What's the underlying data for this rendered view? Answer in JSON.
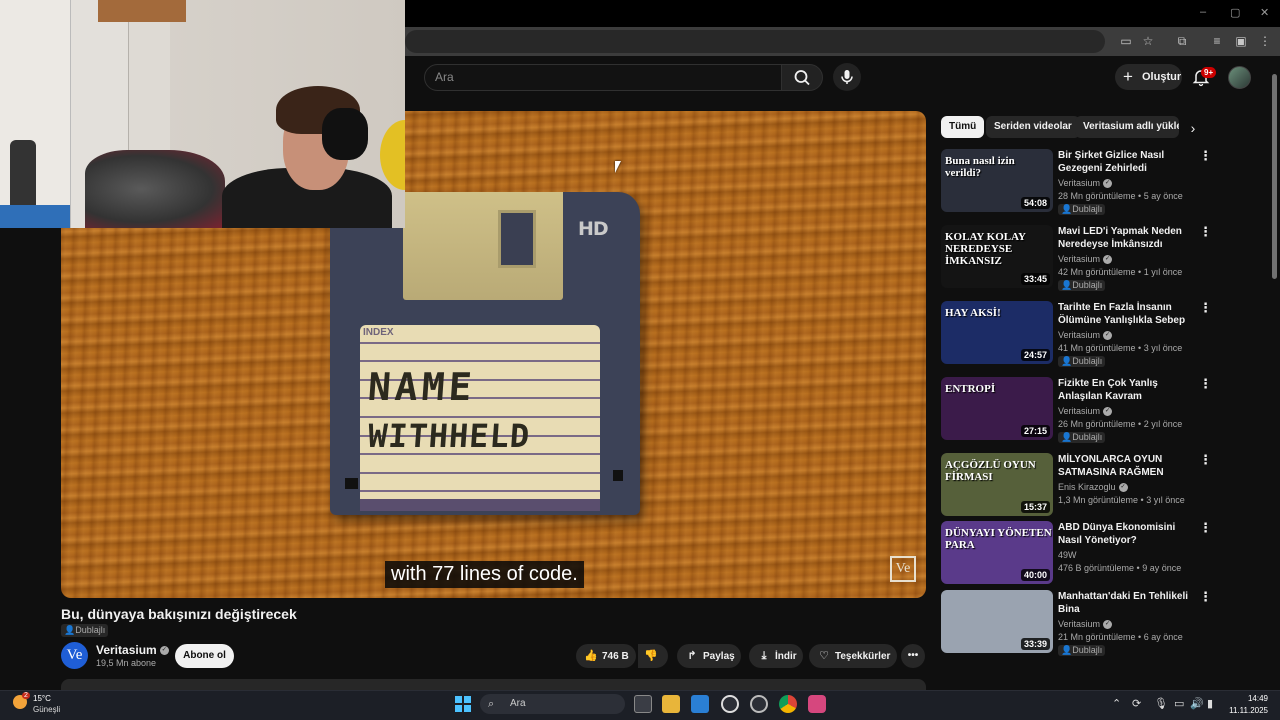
{
  "browser": {
    "window_controls": [
      "–",
      "▢",
      "✕"
    ],
    "toolbar_icons": [
      "cast-icon",
      "star-icon",
      "extensions-icon",
      "media-icon",
      "profile-icon",
      "menu-icon"
    ]
  },
  "header": {
    "search_placeholder": "Ara",
    "create_label": "Oluştur",
    "notifications_badge": "9+"
  },
  "player": {
    "subtitle": "with 77 lines of code.",
    "watermark": "Ve",
    "disk_label_index": "INDEX",
    "disk_label_line1": "NAME",
    "disk_label_line2": "WITHHELD",
    "disk_mark": "HD"
  },
  "video": {
    "title": "Bu, dünyaya bakışınızı değiştirecek",
    "dub_tag": "Dublajlı",
    "channel": {
      "avatar_text": "Ve",
      "name": "Veritasium",
      "subscribers": "19,5 Mn abone",
      "subscribe_label": "Abone ol"
    },
    "actions": {
      "likes": "746 B",
      "share": "Paylaş",
      "download": "İndir",
      "thanks": "Teşekkürler"
    }
  },
  "sidebar": {
    "chips": [
      "Tümü",
      "Seriden videolar",
      "Veritasium adlı yükle"
    ],
    "recommendations": [
      {
        "title": "Bir Şirket Gizlice Nasıl Gezegeni Zehirledi",
        "channel": "Veritasium",
        "verified": true,
        "meta": "28 Mn görüntüleme • 5 ay önce",
        "dub": "Dublajlı",
        "duration": "54:08",
        "thumb_text": "Buna nasıl izin verildi?",
        "thumb_color": "#2a2e3a"
      },
      {
        "title": "Mavi LED'i Yapmak Neden Neredeyse İmkânsızdı",
        "channel": "Veritasium",
        "verified": true,
        "meta": "42 Mn görüntüleme • 1 yıl önce",
        "dub": "Dublajlı",
        "duration": "33:45",
        "thumb_text": "KOLAY   KOLAY   NEREDEYSE İMKANSIZ",
        "thumb_color": "#141414"
      },
      {
        "title": "Tarihte En Fazla İnsanın Ölümüne Yanlışlıkla Sebep Ola...",
        "channel": "Veritasium",
        "verified": true,
        "meta": "41 Mn görüntüleme • 3 yıl önce",
        "dub": "Dublajlı",
        "duration": "24:57",
        "thumb_text": "HAY AKSİ!",
        "thumb_color": "#1c2c66"
      },
      {
        "title": "Fizikte En Çok Yanlış Anlaşılan Kavram",
        "channel": "Veritasium",
        "verified": true,
        "meta": "26 Mn görüntüleme • 2 yıl önce",
        "dub": "Dublajlı",
        "duration": "27:15",
        "thumb_text": "ENTROPİ",
        "thumb_color": "#3b1b4a"
      },
      {
        "title": "MİLYONLARCA OYUN SATMASINA RAĞMEN BATAN ...",
        "channel": "Enis Kirazoglu",
        "verified": true,
        "meta": "1,3 Mn görüntüleme • 3 yıl önce",
        "dub": "",
        "duration": "15:37",
        "thumb_text": "AÇGÖZLÜ OYUN FİRMASI",
        "thumb_color": "#56603a"
      },
      {
        "title": "ABD Dünya Ekonomisini Nasıl Yönetiyor?",
        "channel": "49W",
        "verified": false,
        "meta": "476 B görüntüleme • 9 ay önce",
        "dub": "",
        "duration": "40:00",
        "thumb_text": "DÜNYAYI YÖNETEN PARA",
        "thumb_color": "#5a3a8a"
      },
      {
        "title": "Manhattan'daki En Tehlikeli Bina",
        "channel": "Veritasium",
        "verified": true,
        "meta": "21 Mn görüntüleme • 6 ay önce",
        "dub": "Dublajlı",
        "duration": "33:39",
        "thumb_text": "",
        "thumb_color": "#9aa3b0"
      }
    ]
  },
  "taskbar": {
    "weather_temp": "15°C",
    "weather_desc": "Güneşli",
    "weather_badge": "2",
    "search_placeholder": "Ara",
    "time": "14:49",
    "date": "11.11.2025"
  }
}
